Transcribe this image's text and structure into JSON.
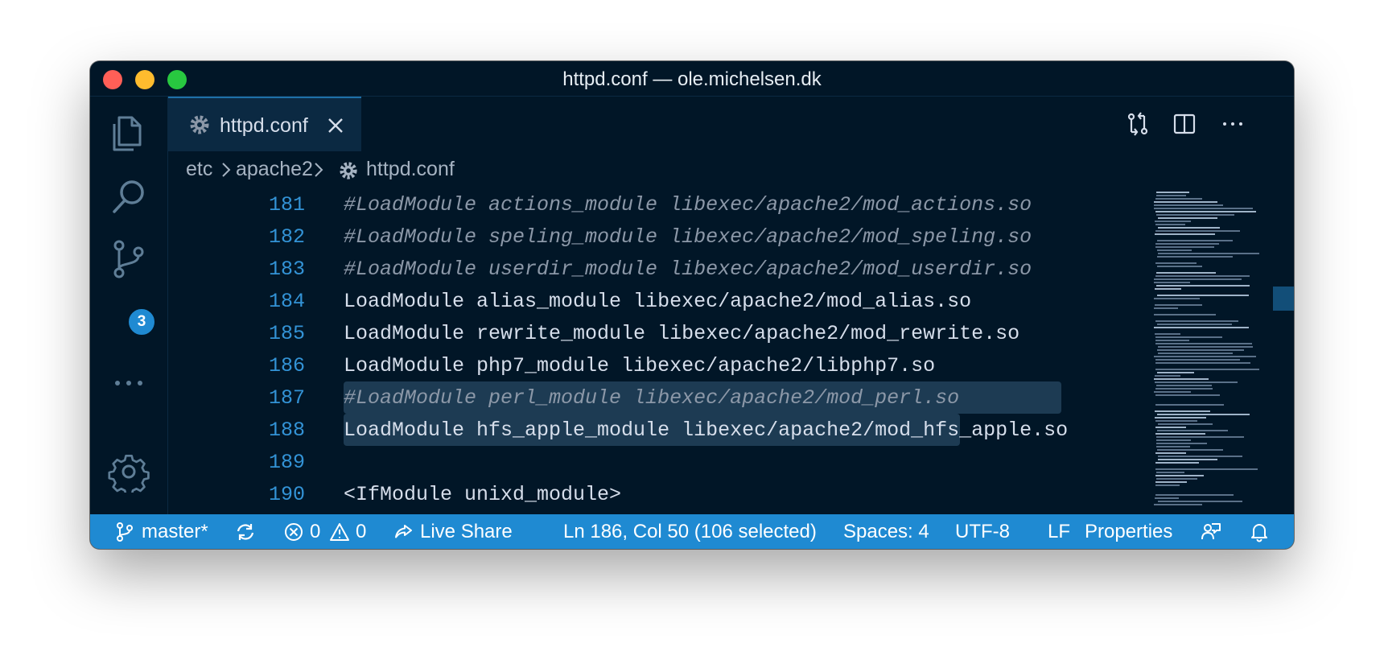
{
  "window": {
    "title": "httpd.conf — ole.michelsen.dk"
  },
  "activity_bar": {
    "items": [
      "files-icon",
      "search-icon",
      "source-control-icon",
      "more-icon",
      "settings-gear-icon"
    ],
    "source_control_badge": "3"
  },
  "tabs": [
    {
      "label": "httpd.conf",
      "icon": "gear-icon",
      "active": true
    }
  ],
  "breadcrumb": {
    "parts": [
      "etc",
      "apache2",
      "httpd.conf"
    ]
  },
  "editor": {
    "lines": [
      {
        "num": "181",
        "text": "#LoadModule actions_module libexec/apache2/mod_actions.so",
        "comment": true
      },
      {
        "num": "182",
        "text": "#LoadModule speling_module libexec/apache2/mod_speling.so",
        "comment": true
      },
      {
        "num": "183",
        "text": "#LoadModule userdir_module libexec/apache2/mod_userdir.so",
        "comment": true
      },
      {
        "num": "184",
        "text": "LoadModule alias_module libexec/apache2/mod_alias.so",
        "comment": false
      },
      {
        "num": "185",
        "text": "LoadModule rewrite_module libexec/apache2/mod_rewrite.so",
        "comment": false,
        "selected": true
      },
      {
        "num": "186",
        "text": "LoadModule php7_module libexec/apache2/libphp7.so",
        "comment": false,
        "selected": true
      },
      {
        "num": "187",
        "text": "#LoadModule perl_module libexec/apache2/mod_perl.so",
        "comment": true
      },
      {
        "num": "188",
        "text": "LoadModule hfs_apple_module libexec/apache2/mod_hfs_apple.so",
        "comment": false
      },
      {
        "num": "189",
        "text": "",
        "comment": false
      },
      {
        "num": "190",
        "text": "<IfModule unixd_module>",
        "comment": false
      }
    ]
  },
  "status_bar": {
    "branch": "master*",
    "errors": "0",
    "warnings": "0",
    "live_share": "Live Share",
    "cursor": "Ln 186, Col 50 (106 selected)",
    "spaces": "Spaces: 4",
    "encoding": "UTF-8",
    "eol": "LF",
    "language": "Properties"
  },
  "colors": {
    "background": "#011627",
    "statusbar": "#1f8ad2",
    "selection": "#1d3b53",
    "line_number": "#3393d6"
  }
}
